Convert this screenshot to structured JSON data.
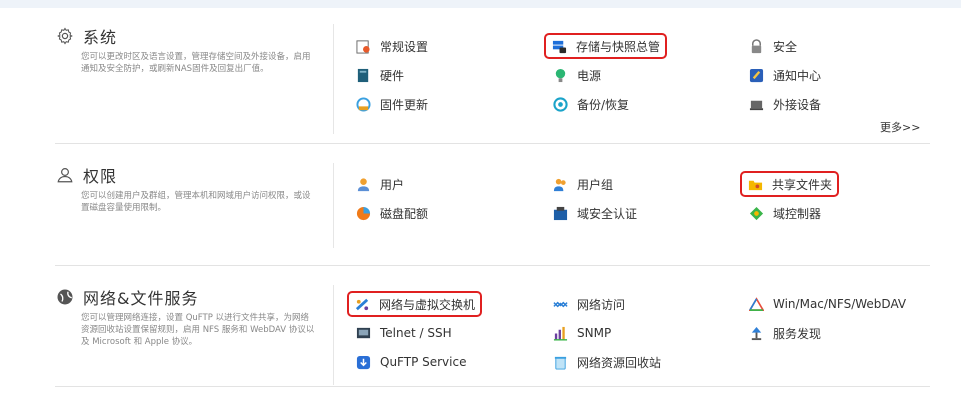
{
  "system": {
    "title": "系统",
    "desc": "您可以更改时区及语言设置，管理存储空间及外接设备，启用通知及安全防护，或刷新NAS固件及回复出厂值。",
    "items": [
      {
        "label": "常规设置",
        "icon": "general-settings-icon",
        "color": "#555555"
      },
      {
        "label": "存储与快照总管",
        "icon": "storage-snapshot-icon",
        "color": "#1e6fd9"
      },
      {
        "label": "安全",
        "icon": "lock-icon",
        "color": "#666666"
      },
      {
        "label": "硬件",
        "icon": "hardware-icon",
        "color": "#1f5f7a"
      },
      {
        "label": "电源",
        "icon": "power-bulb-icon",
        "color": "#2bb673"
      },
      {
        "label": "通知中心",
        "icon": "notification-icon",
        "color": "#2a5fb8"
      },
      {
        "label": "固件更新",
        "icon": "firmware-update-icon",
        "color": "#3aa0e0"
      },
      {
        "label": "备份/恢复",
        "icon": "backup-restore-icon",
        "color": "#1aa3c9"
      },
      {
        "label": "外接设备",
        "icon": "external-device-icon",
        "color": "#555555"
      }
    ],
    "more": "更多>>"
  },
  "privilege": {
    "title": "权限",
    "desc": "您可以创建用户及群组，管理本机和网域用户访问权限，或设置磁盘容量使用限制。",
    "items": [
      {
        "label": "用户",
        "icon": "user-icon",
        "color": "#f0a030"
      },
      {
        "label": "用户组",
        "icon": "user-group-icon",
        "color": "#2f7fd6"
      },
      {
        "label": "共享文件夹",
        "icon": "shared-folder-icon",
        "color": "#f5b700"
      },
      {
        "label": "磁盘配额",
        "icon": "disk-quota-icon",
        "color": "#f07a18"
      },
      {
        "label": "域安全认证",
        "icon": "domain-security-icon",
        "color": "#1e5fa8"
      },
      {
        "label": "域控制器",
        "icon": "domain-controller-icon",
        "color": "#3ab54a"
      }
    ]
  },
  "network": {
    "title": "网络&文件服务",
    "desc": "您可以管理网络连接，设置 QuFTP 以进行文件共享，为网络资源回收站设置保留规则，启用 NFS 服务和 WebDAV 协议以及 Microsoft 和 Apple 协议。",
    "items": [
      {
        "label": "网络与虚拟交换机",
        "icon": "network-vswitch-icon",
        "color": "#2a7fd6"
      },
      {
        "label": "网络访问",
        "icon": "network-access-icon",
        "color": "#2a7fd6"
      },
      {
        "label": "Win/Mac/NFS/WebDAV",
        "icon": "file-protocols-icon",
        "color": "#e94e3c"
      },
      {
        "label": "Telnet / SSH",
        "icon": "terminal-icon",
        "color": "#2f4050"
      },
      {
        "label": "SNMP",
        "icon": "snmp-icon",
        "color": "#6b3fa0"
      },
      {
        "label": "服务发现",
        "icon": "service-discovery-icon",
        "color": "#2f7fd6"
      },
      {
        "label": "QuFTP Service",
        "icon": "quftp-icon",
        "color": "#2a6fd6"
      },
      {
        "label": "网络资源回收站",
        "icon": "recycle-bin-icon",
        "color": "#3aa0e0"
      }
    ]
  }
}
